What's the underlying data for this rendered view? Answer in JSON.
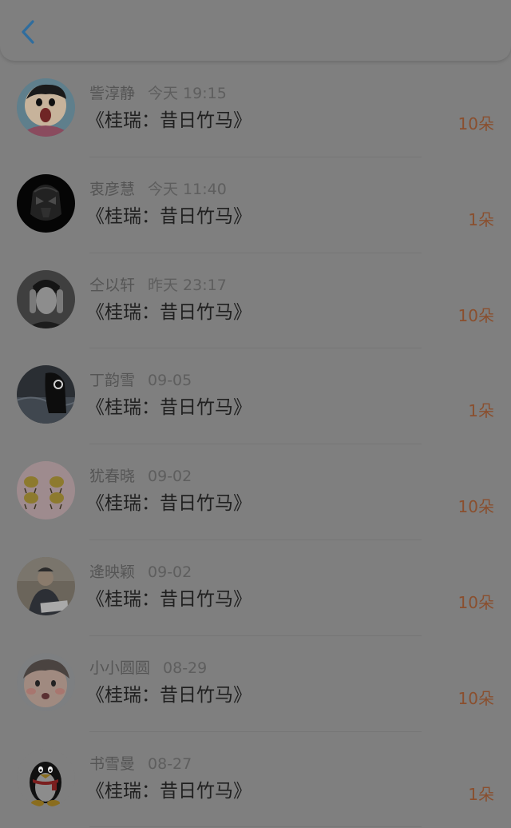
{
  "header": {
    "back_icon": "chevron-left-icon",
    "accent_color": "#2f6d9e"
  },
  "records": [
    {
      "name": "訾淳静",
      "time": "今天 19:15",
      "title": "《桂瑞：昔日竹马》",
      "count": "10朵",
      "avatar": "cartoon-boy"
    },
    {
      "name": "衷彦慧",
      "time": "今天 11:40",
      "title": "《桂瑞：昔日竹马》",
      "count": "1朵",
      "avatar": "dark-helmet"
    },
    {
      "name": "仝以轩",
      "time": "昨天 23:17",
      "title": "《桂瑞：昔日竹马》",
      "count": "10朵",
      "avatar": "portrait-man"
    },
    {
      "name": "丁韵雪",
      "time": "09-05",
      "title": "《桂瑞：昔日竹马》",
      "count": "1朵",
      "avatar": "headphones"
    },
    {
      "name": "犹春晓",
      "time": "09-02",
      "title": "《桂瑞：昔日竹马》",
      "count": "10朵",
      "avatar": "yellow-birds"
    },
    {
      "name": "逄映颖",
      "time": "09-02",
      "title": "《桂瑞：昔日竹马》",
      "count": "10朵",
      "avatar": "person-desk"
    },
    {
      "name": "小小圆圆",
      "time": "08-29",
      "title": "《桂瑞：昔日竹马》",
      "count": "10朵",
      "avatar": "baby-face"
    },
    {
      "name": "书雪曼",
      "time": "08-27",
      "title": "《桂瑞：昔日竹马》",
      "count": "1朵",
      "avatar": "penguin"
    }
  ]
}
